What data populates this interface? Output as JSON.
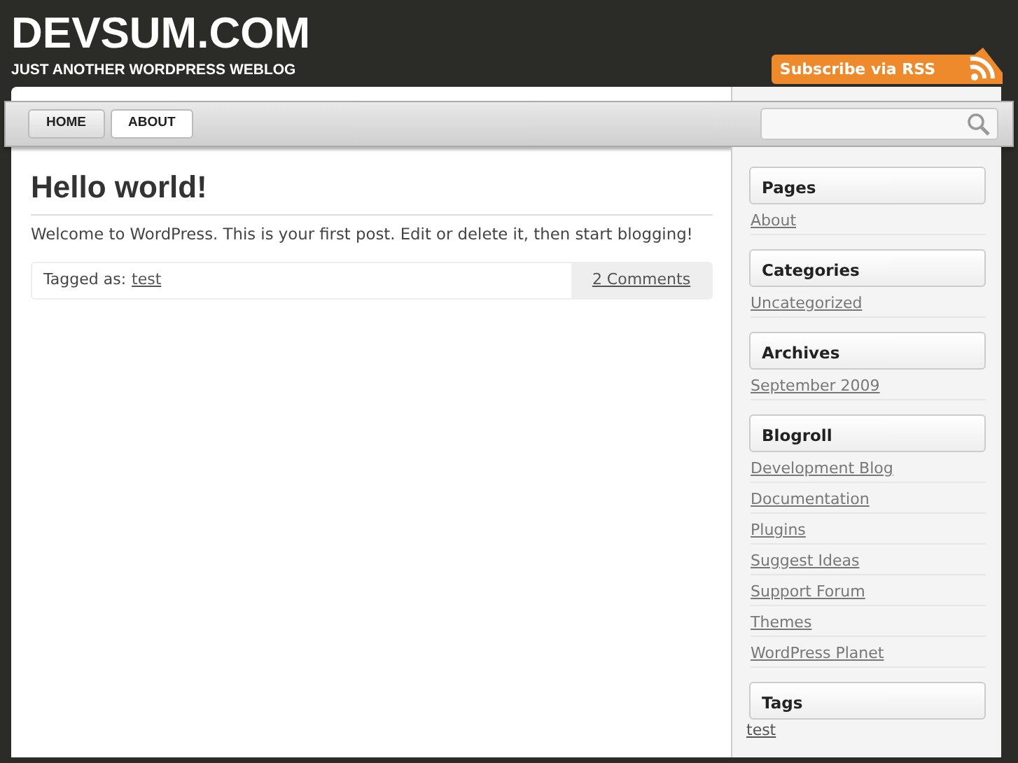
{
  "site": {
    "title": "DEVSUM.COM",
    "tagline": "JUST ANOTHER WORDPRESS WEBLOG",
    "rss_label": "Subscribe via RSS"
  },
  "nav": [
    {
      "label": "HOME",
      "selected": true
    },
    {
      "label": "ABOUT",
      "selected": false
    }
  ],
  "post": {
    "title": "Hello world!",
    "body": "Welcome to WordPress. This is your first post. Edit or delete it, then start blogging!",
    "tagged_label": "Tagged as:",
    "tag": "test",
    "comments": "2 Comments"
  },
  "sidebar": [
    {
      "title": "Pages",
      "links": [
        "About"
      ]
    },
    {
      "title": "Categories",
      "links": [
        "Uncategorized"
      ]
    },
    {
      "title": "Archives",
      "links": [
        "September 2009"
      ]
    },
    {
      "title": "Blogroll",
      "links": [
        "Development Blog",
        "Documentation",
        "Plugins",
        "Suggest Ideas",
        "Support Forum",
        "Themes",
        "WordPress Planet"
      ]
    },
    {
      "title": "Tags",
      "kind": "cloud",
      "links": [
        "test"
      ]
    }
  ]
}
